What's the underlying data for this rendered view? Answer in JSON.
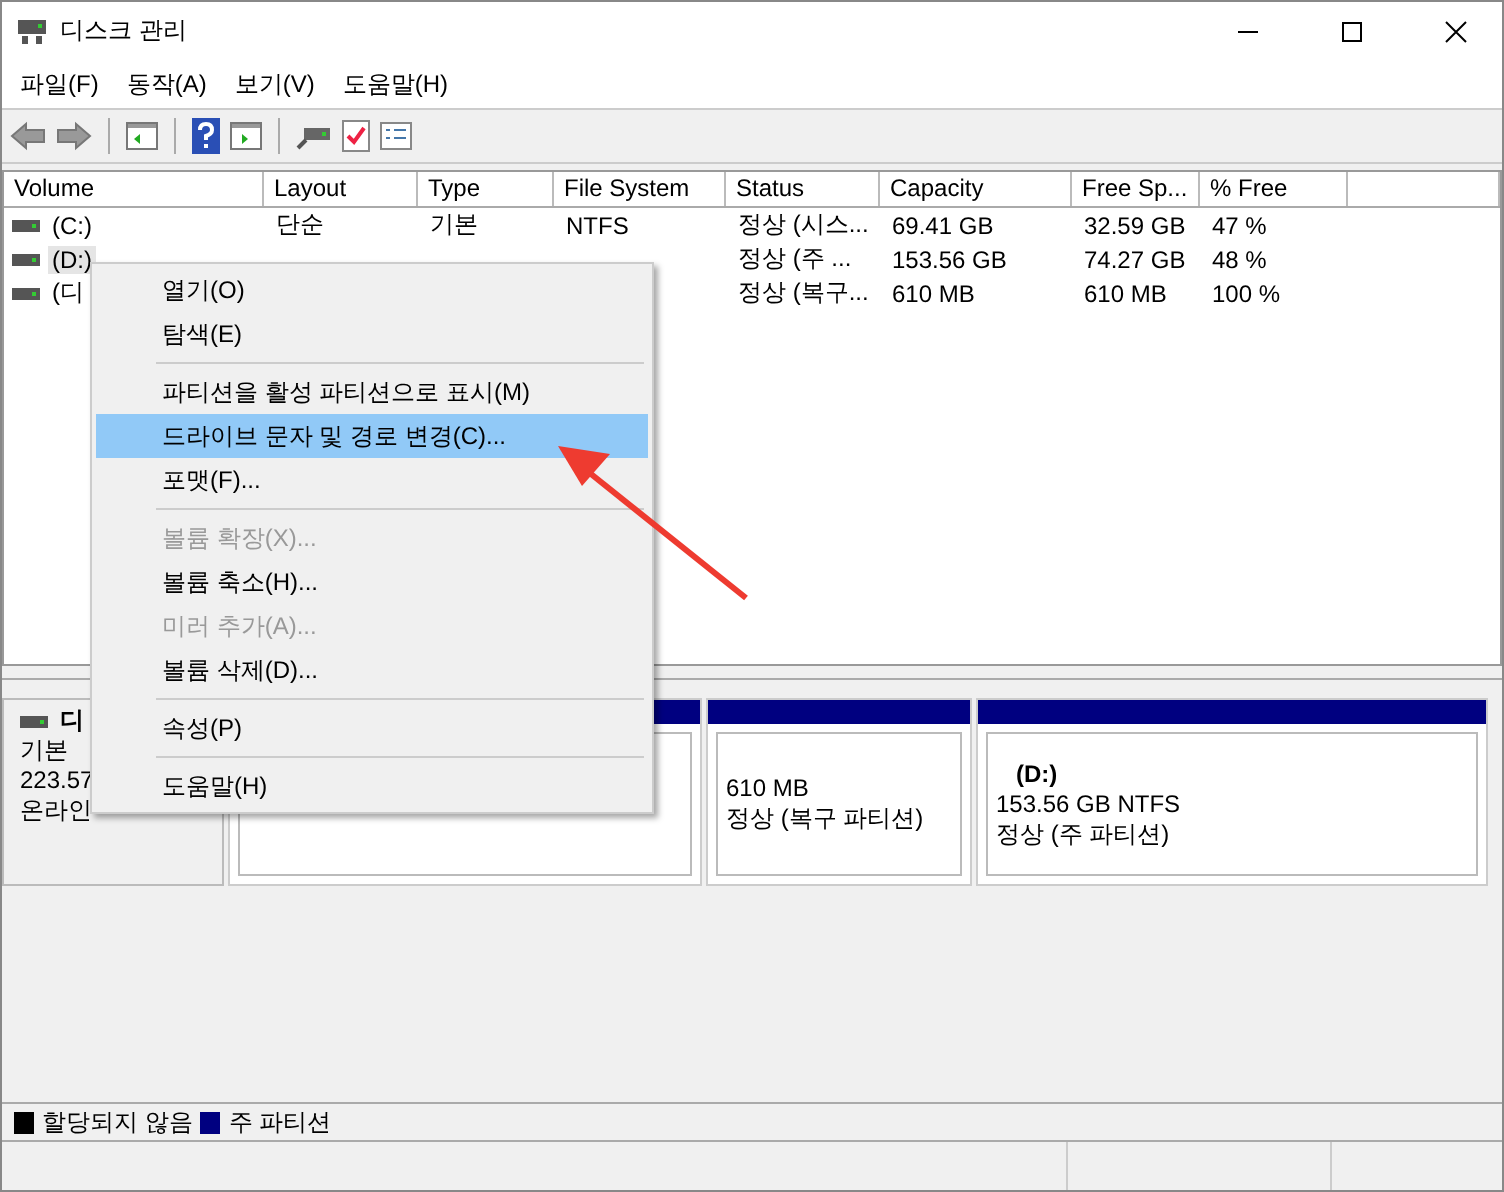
{
  "window": {
    "title": "디스크 관리"
  },
  "menu_bar": [
    "파일(F)",
    "동작(A)",
    "보기(V)",
    "도움말(H)"
  ],
  "volume_list": {
    "columns": [
      "Volume",
      "Layout",
      "Type",
      "File System",
      "Status",
      "Capacity",
      "Free Sp...",
      "% Free"
    ],
    "rows": [
      {
        "selected": false,
        "cells": [
          "(C:)",
          "단순",
          "기본",
          "NTFS",
          "정상 (시스...",
          "69.41 GB",
          "32.59 GB",
          "47 %"
        ]
      },
      {
        "selected": true,
        "cells": [
          "(D:)",
          null,
          null,
          null,
          "정상 (주 ...",
          "153.56 GB",
          "74.27 GB",
          "48 %"
        ]
      },
      {
        "selected": false,
        "cells": [
          "(디",
          null,
          null,
          null,
          "정상 (복구...",
          "610 MB",
          "610 MB",
          "100 %"
        ]
      }
    ]
  },
  "disk": {
    "name": "디",
    "lines": [
      "기본",
      "223.57",
      "온라인"
    ],
    "partitions": [
      {
        "color": "#000080"
      },
      {
        "color": "#000080",
        "lines": [
          "610 MB",
          "정상 (복구 파티션)"
        ]
      },
      {
        "color": "#000080",
        "label": "(D:)",
        "lines": [
          "153.56 GB NTFS",
          "정상 (주 파티션)"
        ]
      }
    ]
  },
  "legend": [
    {
      "label": "할당되지 않음",
      "color": "#000000"
    },
    {
      "label": "주 파티션",
      "color": "#000080"
    }
  ],
  "context_menu": [
    {
      "kind": "item",
      "label": "열기(O)",
      "disabled": false,
      "selected": false
    },
    {
      "kind": "item",
      "label": "탐색(E)",
      "disabled": false,
      "selected": false
    },
    {
      "kind": "separator"
    },
    {
      "kind": "item",
      "label": "파티션을 활성 파티션으로 표시(M)",
      "disabled": false,
      "selected": false
    },
    {
      "kind": "item",
      "label": "드라이브 문자 및 경로 변경(C)...",
      "disabled": false,
      "selected": true
    },
    {
      "kind": "item",
      "label": "포맷(F)...",
      "disabled": false,
      "selected": false
    },
    {
      "kind": "separator"
    },
    {
      "kind": "item",
      "label": "볼륨 확장(X)...",
      "disabled": true,
      "selected": false
    },
    {
      "kind": "item",
      "label": "볼륨 축소(H)...",
      "disabled": false,
      "selected": false
    },
    {
      "kind": "item",
      "label": "미러 추가(A)...",
      "disabled": true,
      "selected": false
    },
    {
      "kind": "item",
      "label": "볼륨 삭제(D)...",
      "disabled": false,
      "selected": false
    },
    {
      "kind": "separator"
    },
    {
      "kind": "item",
      "label": "속성(P)",
      "disabled": false,
      "selected": false
    },
    {
      "kind": "separator"
    },
    {
      "kind": "item",
      "label": "도움말(H)",
      "disabled": false,
      "selected": false
    }
  ]
}
